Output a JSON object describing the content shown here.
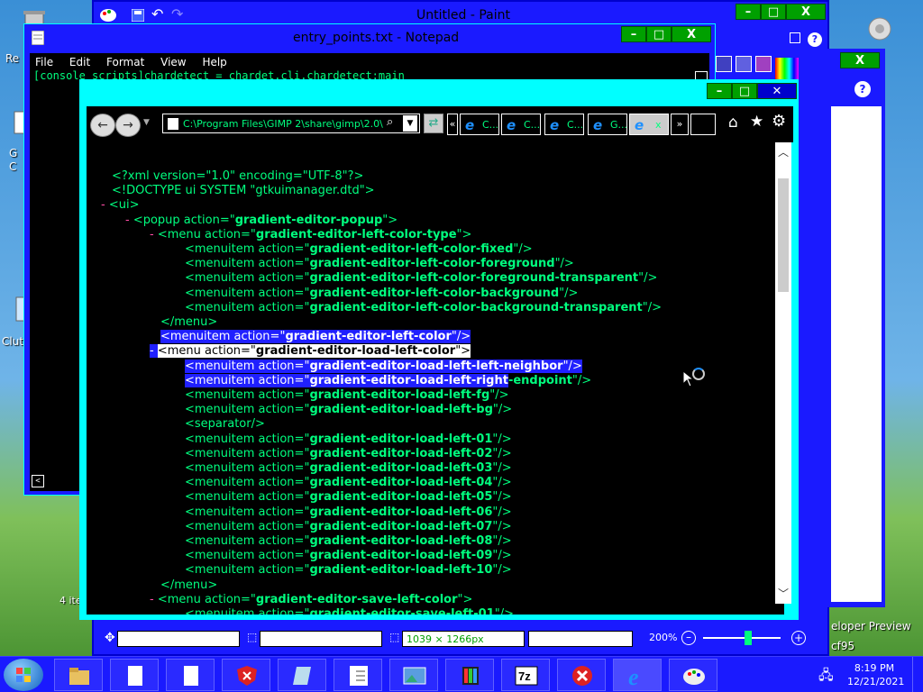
{
  "desktop": {
    "icons": [
      {
        "name": "recycle-bin",
        "label": "Re"
      },
      {
        "name": "gimp",
        "label": "G"
      },
      {
        "name": "gimp2",
        "label": "C"
      },
      {
        "name": "clutter",
        "label": "Clut"
      }
    ],
    "right_partial_labels": [
      "eloper Preview",
      "cf95"
    ]
  },
  "paint": {
    "title": "Untitled - Paint",
    "status": {
      "image_size": "1039 × 1266px",
      "zoom": "200%"
    }
  },
  "notepad": {
    "title": "entry_points.txt - Notepad",
    "menu": [
      "File",
      "Edit",
      "Format",
      "View",
      "Help"
    ],
    "content_line": "[console_scripts]chardetect = chardet.cli.chardetect:main",
    "status_left": "4 ite"
  },
  "ie": {
    "address": "C:\\Program Files\\GIMP 2\\share\\gimp\\2.0\\",
    "tabs": [
      {
        "label": "C..."
      },
      {
        "label": "C..."
      },
      {
        "label": "C..."
      },
      {
        "label": "G..."
      },
      {
        "label": "x",
        "active": true
      }
    ],
    "xml_lines": [
      {
        "indent": 0,
        "prefix": "",
        "text": "<?xml version=\"1.0\" encoding=\"UTF-8\"?>"
      },
      {
        "indent": 0,
        "prefix": "",
        "text": "<!DOCTYPE ui SYSTEM \"gtkuimanager.dtd\">"
      },
      {
        "indent": 0,
        "prefix": "- ",
        "text": "<ui>"
      },
      {
        "indent": 1,
        "prefix": "- ",
        "pre": "<popup action=\"",
        "val": "gradient-editor-popup",
        "post": "\">"
      },
      {
        "indent": 2,
        "prefix": "- ",
        "pre": "<menu action=\"",
        "val": "gradient-editor-left-color-type",
        "post": "\">"
      },
      {
        "indent": 3,
        "prefix": "",
        "pre": "<menuitem action=\"",
        "val": "gradient-editor-left-color-fixed",
        "post": "\"/>"
      },
      {
        "indent": 3,
        "prefix": "",
        "pre": "<menuitem action=\"",
        "val": "gradient-editor-left-color-foreground",
        "post": "\"/>"
      },
      {
        "indent": 3,
        "prefix": "",
        "pre": "<menuitem action=\"",
        "val": "gradient-editor-left-color-foreground-transparent",
        "post": "\"/>"
      },
      {
        "indent": 3,
        "prefix": "",
        "pre": "<menuitem action=\"",
        "val": "gradient-editor-left-color-background",
        "post": "\"/>"
      },
      {
        "indent": 3,
        "prefix": "",
        "pre": "<menuitem action=\"",
        "val": "gradient-editor-left-color-background-transparent",
        "post": "\"/>"
      },
      {
        "indent": 2,
        "prefix": "",
        "text": "</menu>"
      },
      {
        "indent": 2,
        "prefix": "",
        "pre": "<menuitem action=\"",
        "val": "gradient-editor-left-color",
        "post": "\"/>",
        "sel": "blue"
      },
      {
        "indent": 2,
        "prefix": "- ",
        "pre": "<menu action=\"",
        "val": "gradient-editor-load-left-color",
        "post": "\">",
        "sel": "white"
      },
      {
        "indent": 3,
        "prefix": "",
        "pre": "<menuitem action=\"",
        "val": "gradient-editor-load-left-left-neighbor",
        "post": "\"/>",
        "sel": "blue"
      },
      {
        "indent": 3,
        "prefix": "",
        "pre": "<menuitem action=\"",
        "val": "gradient-editor-load-left-right-endpoint",
        "post": "\"/>",
        "sel": "blue-partial"
      },
      {
        "indent": 3,
        "prefix": "",
        "pre": "<menuitem action=\"",
        "val": "gradient-editor-load-left-fg",
        "post": "\"/>"
      },
      {
        "indent": 3,
        "prefix": "",
        "pre": "<menuitem action=\"",
        "val": "gradient-editor-load-left-bg",
        "post": "\"/>"
      },
      {
        "indent": 3,
        "prefix": "",
        "text": "<separator/>"
      },
      {
        "indent": 3,
        "prefix": "",
        "pre": "<menuitem action=\"",
        "val": "gradient-editor-load-left-01",
        "post": "\"/>"
      },
      {
        "indent": 3,
        "prefix": "",
        "pre": "<menuitem action=\"",
        "val": "gradient-editor-load-left-02",
        "post": "\"/>"
      },
      {
        "indent": 3,
        "prefix": "",
        "pre": "<menuitem action=\"",
        "val": "gradient-editor-load-left-03",
        "post": "\"/>"
      },
      {
        "indent": 3,
        "prefix": "",
        "pre": "<menuitem action=\"",
        "val": "gradient-editor-load-left-04",
        "post": "\"/>"
      },
      {
        "indent": 3,
        "prefix": "",
        "pre": "<menuitem action=\"",
        "val": "gradient-editor-load-left-05",
        "post": "\"/>"
      },
      {
        "indent": 3,
        "prefix": "",
        "pre": "<menuitem action=\"",
        "val": "gradient-editor-load-left-06",
        "post": "\"/>"
      },
      {
        "indent": 3,
        "prefix": "",
        "pre": "<menuitem action=\"",
        "val": "gradient-editor-load-left-07",
        "post": "\"/>"
      },
      {
        "indent": 3,
        "prefix": "",
        "pre": "<menuitem action=\"",
        "val": "gradient-editor-load-left-08",
        "post": "\"/>"
      },
      {
        "indent": 3,
        "prefix": "",
        "pre": "<menuitem action=\"",
        "val": "gradient-editor-load-left-09",
        "post": "\"/>"
      },
      {
        "indent": 3,
        "prefix": "",
        "pre": "<menuitem action=\"",
        "val": "gradient-editor-load-left-10",
        "post": "\"/>"
      },
      {
        "indent": 2,
        "prefix": "",
        "text": "</menu>"
      },
      {
        "indent": 2,
        "prefix": "- ",
        "pre": "<menu action=\"",
        "val": "gradient-editor-save-left-color",
        "post": "\">"
      },
      {
        "indent": 3,
        "prefix": "",
        "pre": "<menuitem action=\"",
        "val": "gradient-editor-save-left-01",
        "post": "\"/>"
      }
    ]
  },
  "taskbar": {
    "apps": [
      "start",
      "explorer",
      "file",
      "file2",
      "shield",
      "notes",
      "checklist",
      "photo",
      "gimp",
      "7zip",
      "stop",
      "ie",
      "paint"
    ],
    "time": "8:19 PM",
    "date": "12/21/2021"
  },
  "colors": {
    "window_blue": "#1a1aff",
    "cyan_frame": "#00ffff",
    "text_green": "#00ff7f",
    "caption_green": "#00a000"
  }
}
